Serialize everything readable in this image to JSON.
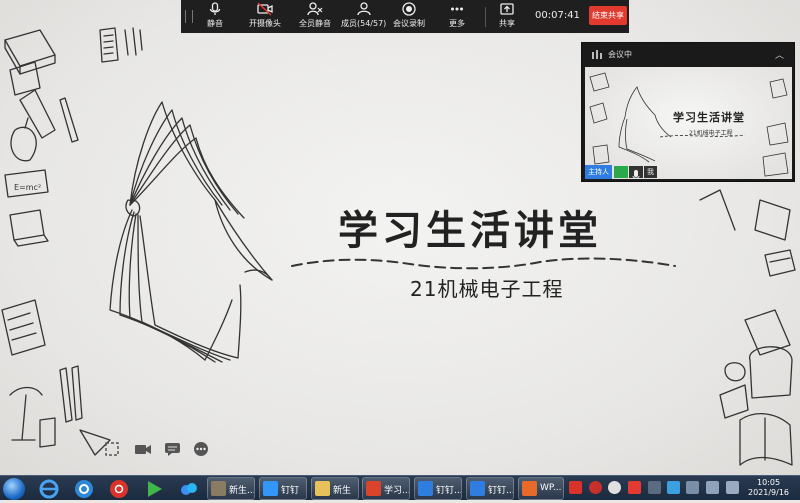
{
  "meeting_bar": {
    "tools": [
      {
        "label": "静音",
        "icon": "microphone-icon"
      },
      {
        "label": "开摄像头",
        "icon": "camera-off-icon"
      },
      {
        "label": "全员静音",
        "icon": "mute-all-icon"
      },
      {
        "label": "成员(54/57)",
        "icon": "members-icon"
      },
      {
        "label": "会议录制",
        "icon": "record-icon"
      },
      {
        "label": "更多",
        "icon": "more-icon"
      },
      {
        "label": "共享",
        "icon": "share-icon"
      }
    ],
    "timer": "00:07:41",
    "end_share": "结束共享"
  },
  "slide": {
    "title": "学习生活讲堂",
    "subtitle": "21机械电子工程"
  },
  "mini_panel": {
    "status": "会议中",
    "video_title": "学习生活讲堂",
    "video_subtitle": "21机械电子工程",
    "host_label": "主持人",
    "me_label": "我"
  },
  "taskbar": {
    "tasks": [
      {
        "label": "新生..."
      },
      {
        "label": "钉钉"
      },
      {
        "label": "新生"
      },
      {
        "label": "学习..."
      },
      {
        "label": "钉钉..."
      },
      {
        "label": "钉钉..."
      },
      {
        "label": "WP..."
      }
    ],
    "clock_time": "10:05",
    "clock_date": "2021/9/16"
  },
  "colors": {
    "end_share": "#e23a2e",
    "host_tag": "#2f7de1",
    "camera_tag": "#2aa84a",
    "toolbar_bg": "#1f1f1f"
  }
}
